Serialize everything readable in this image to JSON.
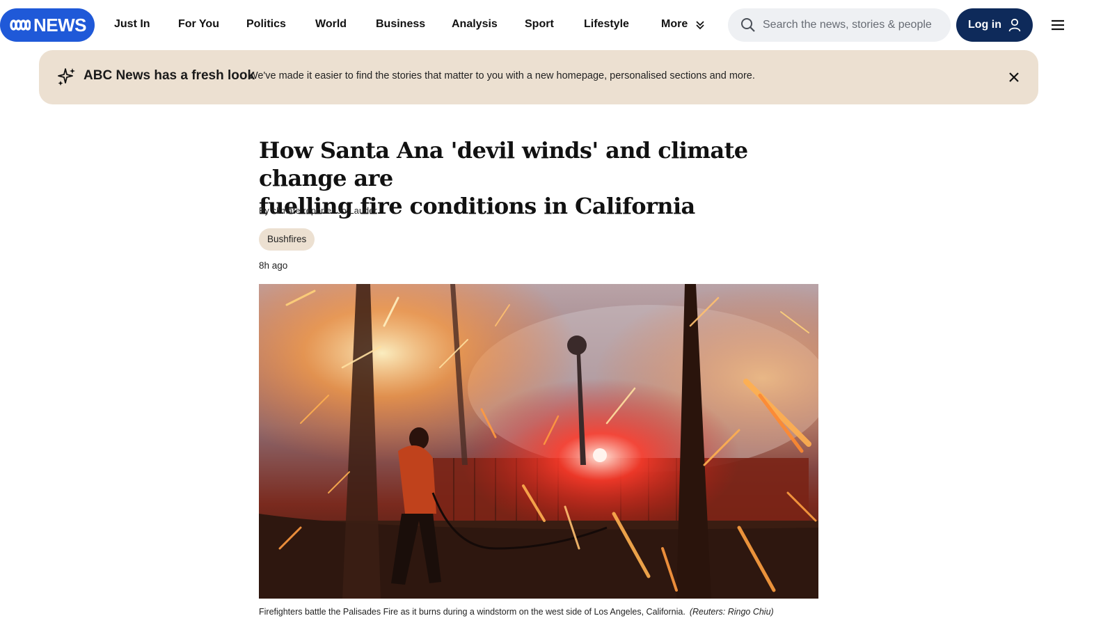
{
  "header": {
    "logo_text": "NEWS",
    "nav": [
      {
        "label": "Just In"
      },
      {
        "label": "For You"
      },
      {
        "label": "Politics"
      },
      {
        "label": "World"
      },
      {
        "label": "Business"
      },
      {
        "label": "Analysis"
      },
      {
        "label": "Sport"
      },
      {
        "label": "Lifestyle"
      },
      {
        "label": "More"
      }
    ],
    "search": {
      "placeholder": "Search the news, stories & people"
    },
    "login_label": "Log in",
    "icons": {
      "search": "search-icon",
      "user": "user-icon",
      "menu": "hamburger-menu-icon",
      "more": "double-chevron-down-icon"
    }
  },
  "banner": {
    "title": "ABC News has a fresh look",
    "text": "We've made it easier to find the stories that matter to you with a new homepage, personalised sections and more.",
    "icon": "sparkle-icon",
    "close_icon": "close-icon"
  },
  "article": {
    "headline_line1": "How Santa Ana 'devil winds' and climate change are",
    "headline_line2": "fuelling fire conditions in California",
    "byline": "By climate reporter Jo Lauder",
    "tag": "Bushfires",
    "published": "8h ago",
    "image_caption": "Firefighters battle the Palisades Fire as it burns during a windstorm on the west side of Los Angeles, California.",
    "image_credit": "(Reuters: Ringo Chiu)"
  },
  "colors": {
    "brand_blue": "#1f59d8",
    "login_navy": "#0e2a5a",
    "banner_beige": "#ece0d1",
    "search_grey": "#eef0f3"
  }
}
